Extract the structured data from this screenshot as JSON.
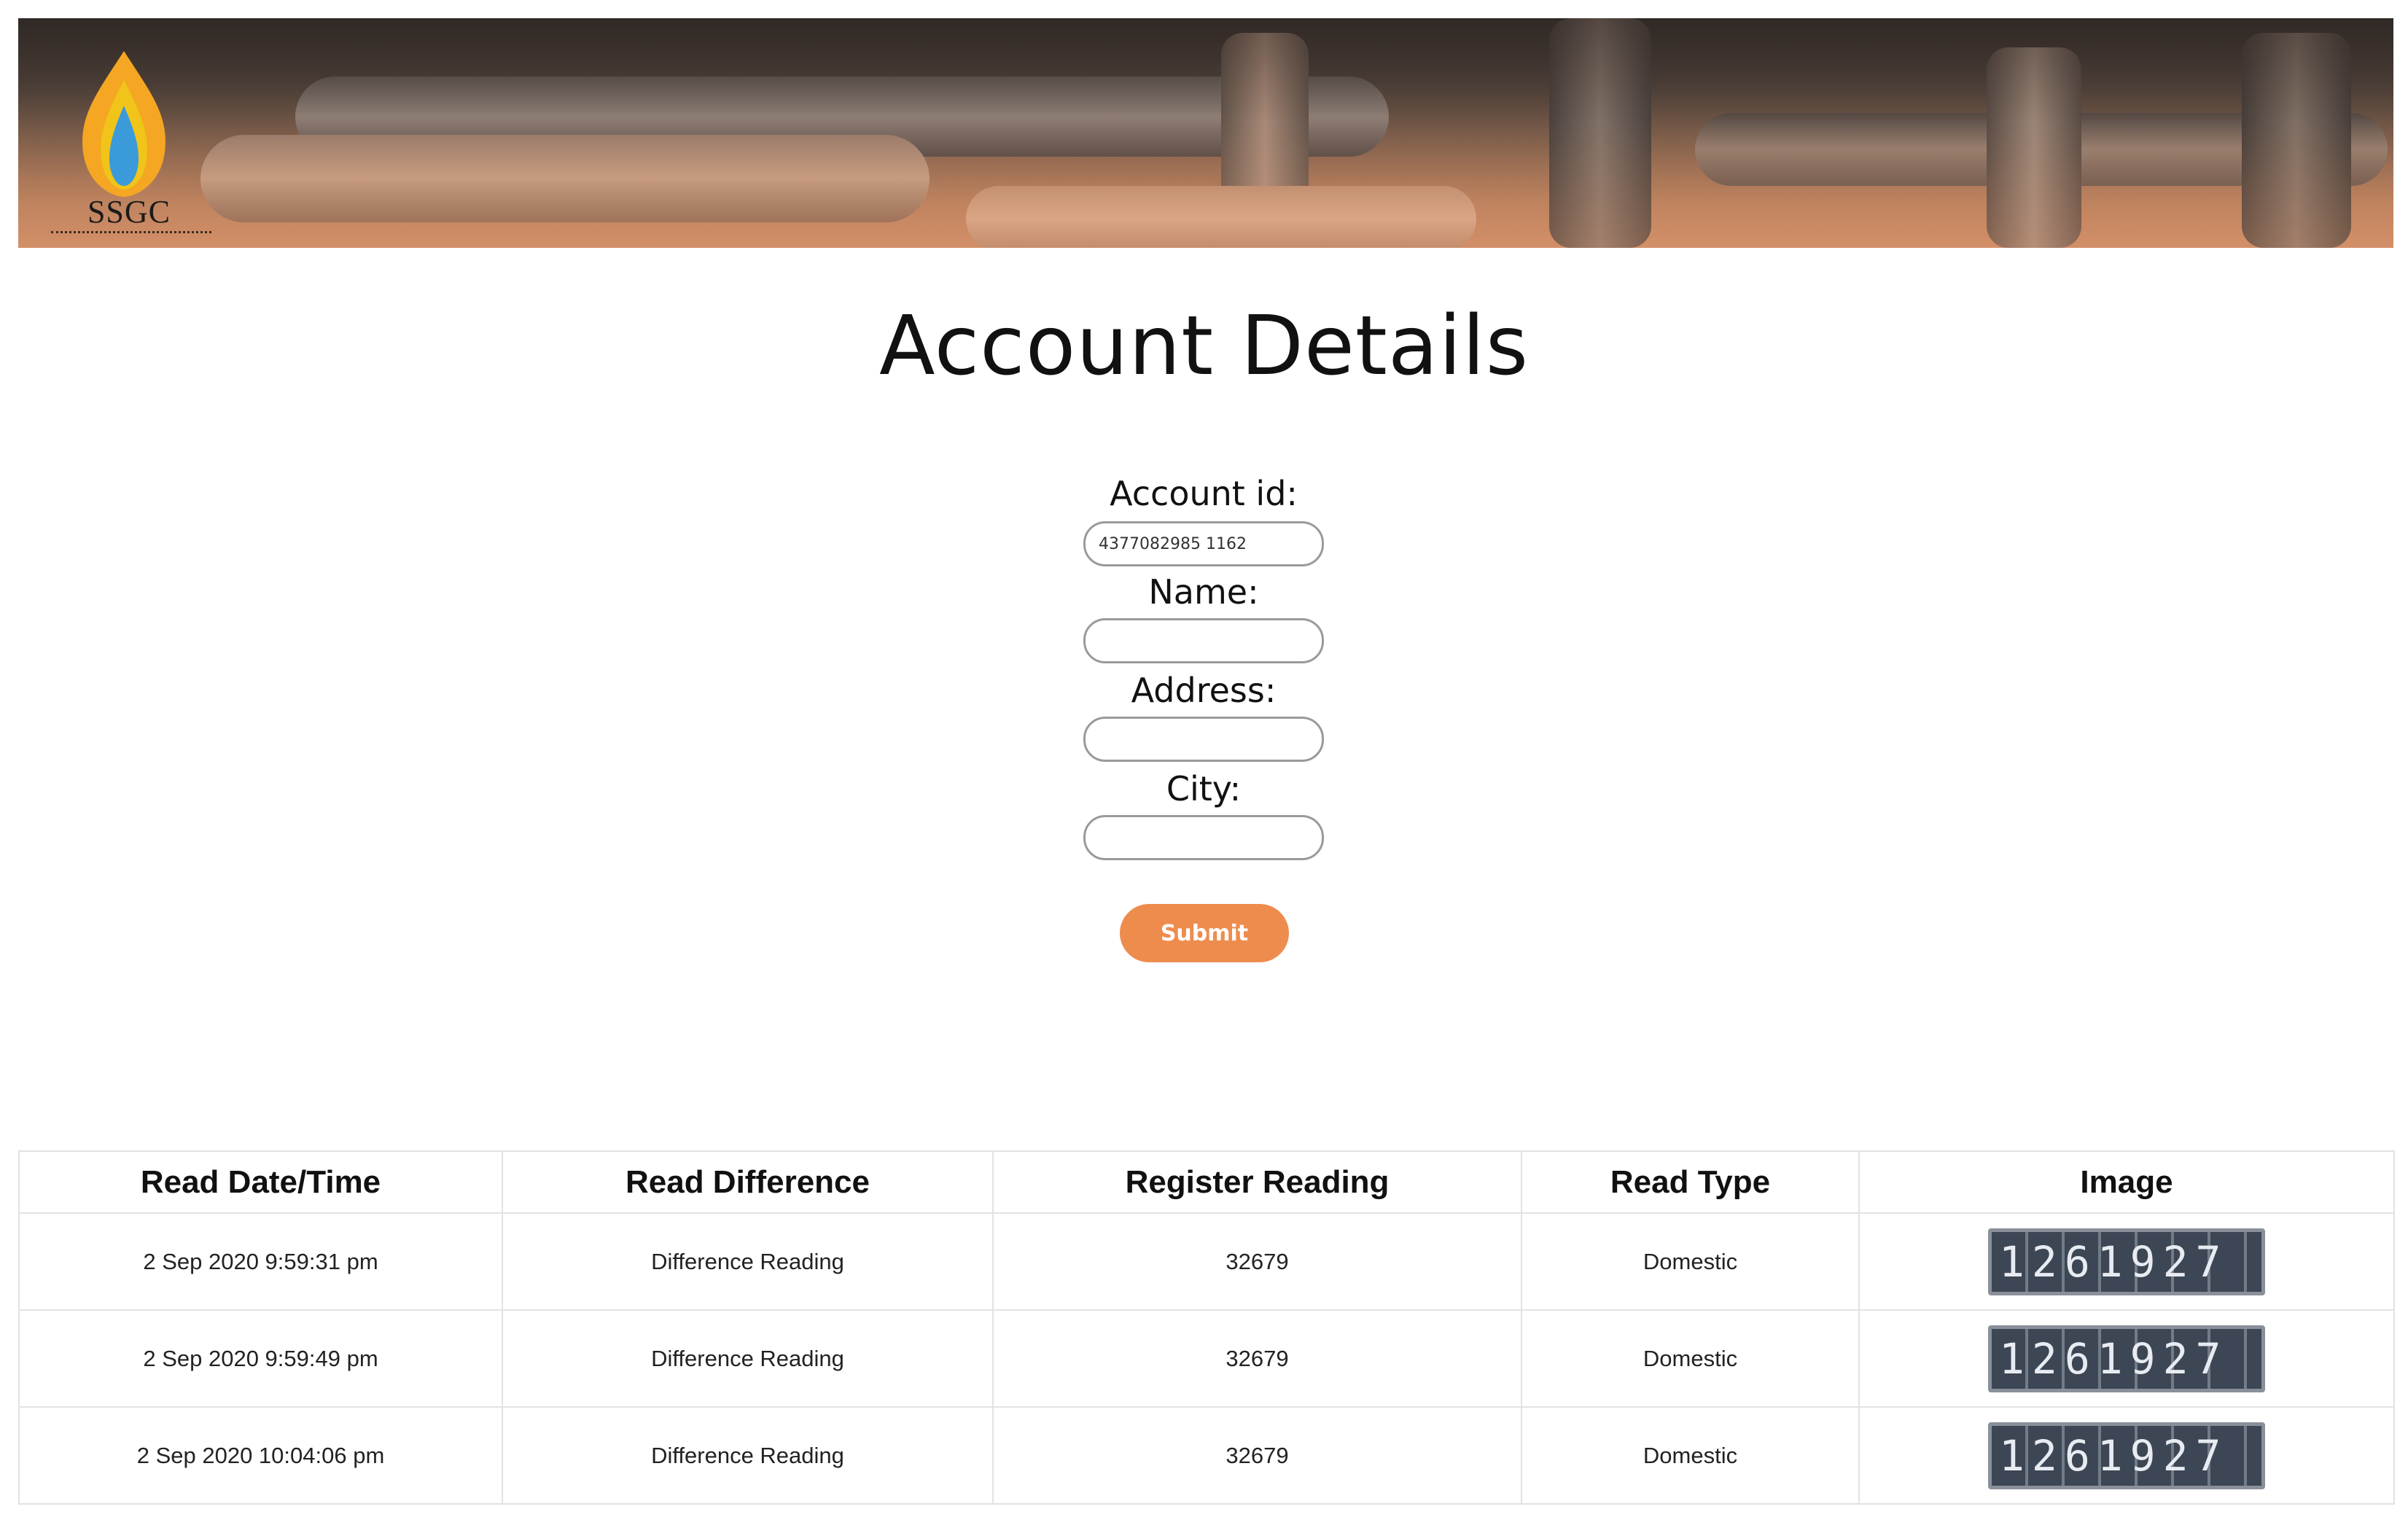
{
  "header": {
    "logo_text": "SSGC",
    "colors": {
      "flame_outer": "#f5a623",
      "flame_inner": "#3b9ad9"
    }
  },
  "page_title": "Account Details",
  "form": {
    "account_id": {
      "label": "Account id:",
      "value": "4377082985 1162"
    },
    "name": {
      "label": "Name:",
      "value": ""
    },
    "address": {
      "label": "Address:",
      "value": ""
    },
    "city": {
      "label": "City:",
      "value": ""
    },
    "submit_label": "Submit",
    "submit_color": "#ee8c4e"
  },
  "table": {
    "headers": [
      "Read Date/Time",
      "Read Difference",
      "Register Reading",
      "Read Type",
      "Image"
    ],
    "rows": [
      {
        "datetime": "2 Sep 2020 9:59:31 pm",
        "difference": "Difference Reading",
        "reading": "32679",
        "type": "Domestic",
        "image": "1261927"
      },
      {
        "datetime": "2 Sep 2020 9:59:49 pm",
        "difference": "Difference Reading",
        "reading": "32679",
        "type": "Domestic",
        "image": "1261927"
      },
      {
        "datetime": "2 Sep 2020 10:04:06 pm",
        "difference": "Difference Reading",
        "reading": "32679",
        "type": "Domestic",
        "image": "1261927"
      }
    ]
  }
}
